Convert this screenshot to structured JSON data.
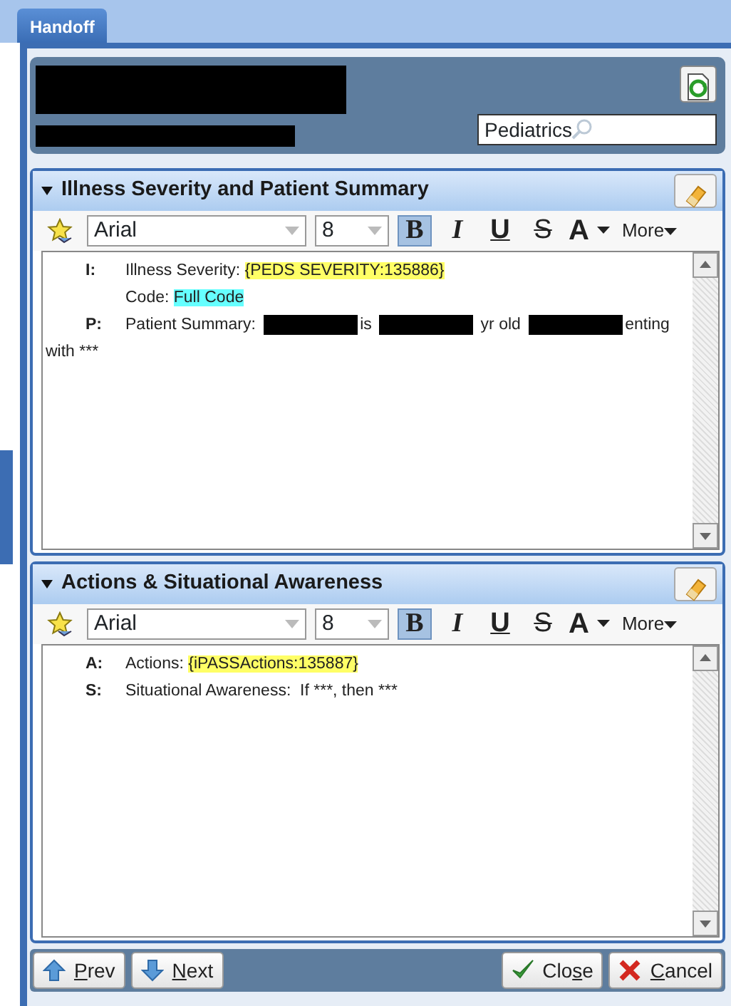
{
  "tab": {
    "label": "Handoff",
    "selected": true
  },
  "header": {
    "redactions": [
      {
        "kind": "redaction"
      },
      {
        "kind": "redaction"
      }
    ],
    "service_filter": {
      "value": "Pediatrics"
    }
  },
  "sections": [
    {
      "title": "Illness Severity and Patient Summary",
      "expanded": true,
      "toolbar": {
        "font": "Arial",
        "size": "8",
        "styles": [
          {
            "kind": "bold",
            "label": "B",
            "on": true
          },
          {
            "kind": "italic",
            "label": "I",
            "on": false
          },
          {
            "kind": "underline",
            "label": "U",
            "on": false
          },
          {
            "kind": "strike",
            "label": "S",
            "on": false
          }
        ],
        "color_label": "A",
        "more": "More"
      },
      "lines": [
        {
          "tag": "I:",
          "segments": [
            {
              "kind": "text",
              "text": "Illness Severity: "
            },
            {
              "kind": "field",
              "text": "{PEDS SEVERITY:135886}",
              "color": "#ffff66"
            }
          ]
        },
        {
          "kind": "plain",
          "segments": [
            {
              "kind": "text",
              "text": "Code: "
            },
            {
              "kind": "field",
              "text": "Full Code",
              "color": "#66ffff"
            }
          ]
        },
        {
          "tag": "P:",
          "segments": [
            {
              "kind": "text",
              "text": "Patient Summary: "
            },
            {
              "kind": "redaction"
            },
            {
              "kind": "text",
              "text": "is "
            },
            {
              "kind": "redaction"
            },
            {
              "kind": "text",
              "text": " yr old "
            },
            {
              "kind": "redaction"
            },
            {
              "kind": "text",
              "text": "enting"
            }
          ]
        },
        {
          "kind": "continuation",
          "segments": [
            {
              "kind": "text",
              "text": "with ***"
            }
          ]
        }
      ]
    },
    {
      "title": "Actions & Situational Awareness",
      "expanded": true,
      "toolbar": {
        "font": "Arial",
        "size": "8",
        "styles": [
          {
            "kind": "bold",
            "label": "B",
            "on": true
          },
          {
            "kind": "italic",
            "label": "I",
            "on": false
          },
          {
            "kind": "underline",
            "label": "U",
            "on": false
          },
          {
            "kind": "strike",
            "label": "S",
            "on": false
          }
        ],
        "color_label": "A",
        "more": "More"
      },
      "lines": [
        {
          "tag": "A:",
          "segments": [
            {
              "kind": "text",
              "text": "Actions: "
            },
            {
              "kind": "field",
              "text": "{iPASSActions:135887}",
              "color": "#ffff66"
            }
          ]
        },
        {
          "tag": "S:",
          "segments": [
            {
              "kind": "text",
              "text": "Situational Awareness:  If ***, then ***"
            }
          ]
        }
      ]
    }
  ],
  "footer": {
    "buttons": [
      {
        "kind": "prev",
        "key": "P",
        "after": "rev"
      },
      {
        "kind": "next",
        "key": "N",
        "after": "ext"
      },
      {
        "kind": "close",
        "before": "Clo",
        "key": "s",
        "after": "e"
      },
      {
        "kind": "cancel",
        "key": "C",
        "after": "ancel"
      }
    ]
  }
}
